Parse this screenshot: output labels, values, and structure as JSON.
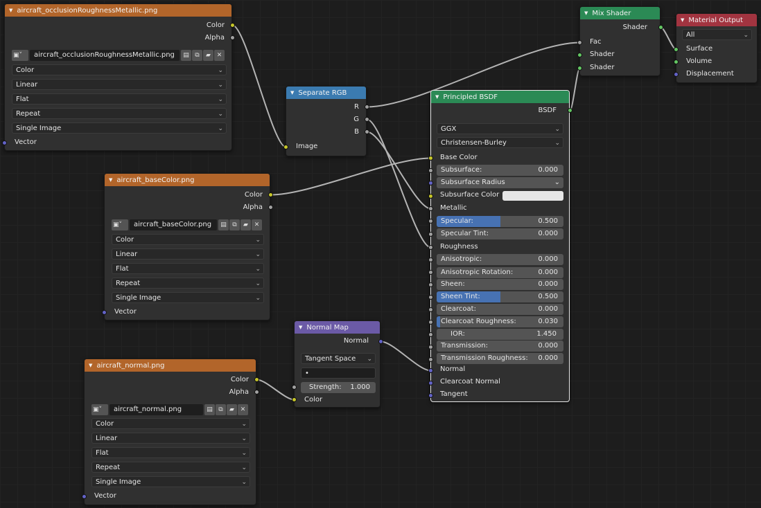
{
  "nodes": {
    "occlusion": {
      "title": "aircraft_occlusionRoughnessMetallic.png",
      "outputs": [
        "Color",
        "Alpha"
      ],
      "image_name": "aircraft_occlusionRoughnessMetallic.png",
      "dropdowns": [
        "Color",
        "Linear",
        "Flat",
        "Repeat",
        "Single Image"
      ],
      "input": "Vector"
    },
    "base": {
      "title": "aircraft_baseColor.png",
      "outputs": [
        "Color",
        "Alpha"
      ],
      "image_name": "aircraft_baseColor.png",
      "dropdowns": [
        "Color",
        "Linear",
        "Flat",
        "Repeat",
        "Single Image"
      ],
      "input": "Vector"
    },
    "normal_tex": {
      "title": "aircraft_normal.png",
      "outputs": [
        "Color",
        "Alpha"
      ],
      "image_name": "aircraft_normal.png",
      "dropdowns": [
        "Color",
        "Linear",
        "Flat",
        "Repeat",
        "Single Image"
      ],
      "input": "Vector"
    },
    "separate": {
      "title": "Separate RGB",
      "outputs": [
        "R",
        "G",
        "B"
      ],
      "input": "Image"
    },
    "normal_map": {
      "title": "Normal Map",
      "output": "Normal",
      "space": "Tangent Space",
      "uv": "•",
      "strength_label": "Strength:",
      "strength_value": "1.000",
      "input": "Color"
    },
    "mix": {
      "title": "Mix Shader",
      "output": "Shader",
      "inputs": [
        "Fac",
        "Shader",
        "Shader"
      ]
    },
    "output": {
      "title": "Material Output",
      "target": "All",
      "inputs": [
        "Surface",
        "Volume",
        "Displacement"
      ]
    },
    "bsdf": {
      "title": "Principled BSDF",
      "output": "BSDF",
      "distribution": "GGX",
      "subsurface_method": "Christensen-Burley",
      "base_color": "Base Color",
      "subsurface": {
        "label": "Subsurface:",
        "value": "0.000"
      },
      "subsurface_radius": "Subsurface Radius",
      "subsurface_color": "Subsurface Color",
      "metallic": "Metallic",
      "specular": {
        "label": "Specular:",
        "value": "0.500",
        "fraction": 0.5
      },
      "specular_tint": {
        "label": "Specular Tint:",
        "value": "0.000"
      },
      "roughness": "Roughness",
      "anisotropic": {
        "label": "Anisotropic:",
        "value": "0.000"
      },
      "anisotropic_rotation": {
        "label": "Anisotropic Rotation:",
        "value": "0.000"
      },
      "sheen": {
        "label": "Sheen:",
        "value": "0.000"
      },
      "sheen_tint": {
        "label": "Sheen Tint:",
        "value": "0.500",
        "fraction": 0.5
      },
      "clearcoat": {
        "label": "Clearcoat:",
        "value": "0.000"
      },
      "clearcoat_roughness": {
        "label": "Clearcoat Roughness:",
        "value": "0.030",
        "fraction": 0.03
      },
      "ior": {
        "label": "IOR:",
        "value": "1.450"
      },
      "transmission": {
        "label": "Transmission:",
        "value": "0.000"
      },
      "transmission_roughness": {
        "label": "Transmission Roughness:",
        "value": "0.000"
      },
      "normal": "Normal",
      "clearcoat_normal": "Clearcoat Normal",
      "tangent": "Tangent"
    }
  },
  "colors": {
    "image_header": "#b2652a",
    "converter_header": "#3b7bb0",
    "vector_header": "#6b5aa6",
    "shader_header": "#2b8a55",
    "output_header": "#a23440",
    "slider_fill": "#4772b3",
    "socket_color": "#c7c729",
    "socket_float": "#a1a1a1",
    "socket_vector": "#6363c7",
    "socket_shader": "#63c763"
  }
}
